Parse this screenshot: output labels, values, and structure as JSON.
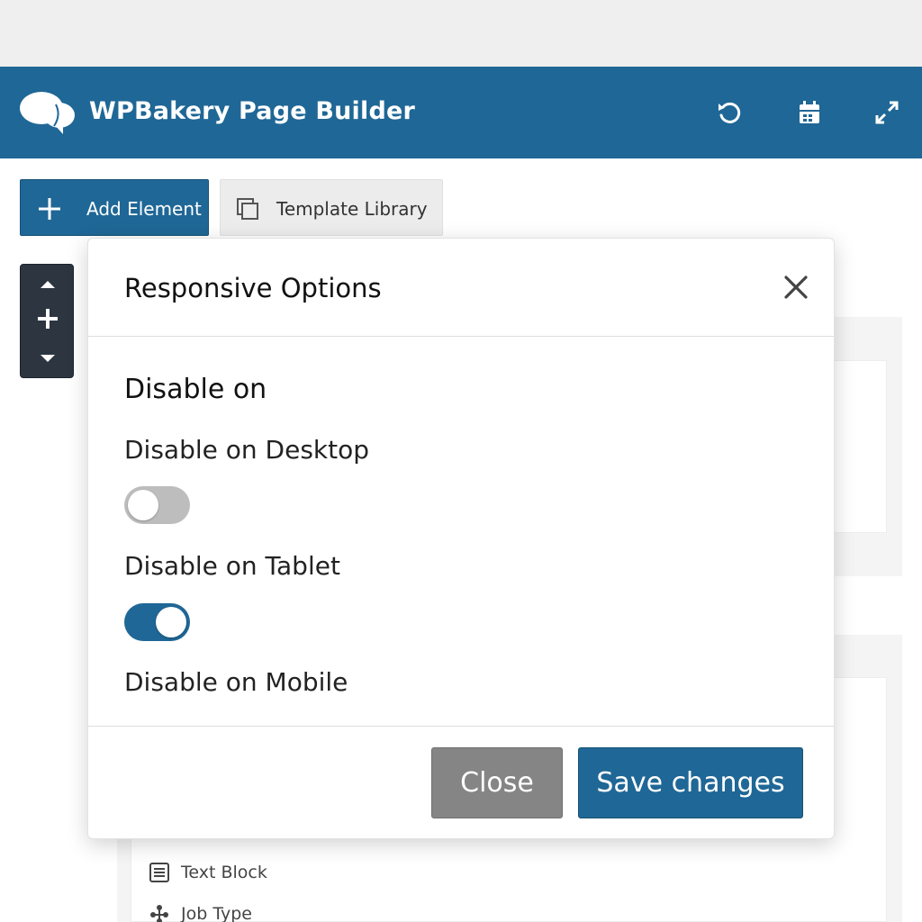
{
  "app": {
    "title": "WPBakery Page Builder"
  },
  "toolbar": {
    "add_element_label": "Add Element",
    "template_library_label": "Template Library"
  },
  "background_elements": [
    {
      "label": "Text Block",
      "icon": "text-block-icon"
    },
    {
      "label": "Job Type",
      "icon": "job-type-icon"
    }
  ],
  "modal": {
    "title": "Responsive Options",
    "section_title": "Disable on",
    "options": [
      {
        "label": "Disable on Desktop",
        "enabled": false
      },
      {
        "label": "Disable on Tablet",
        "enabled": true
      },
      {
        "label": "Disable on Mobile"
      }
    ],
    "close_label": "Close",
    "save_label": "Save changes"
  },
  "colors": {
    "brand": "#1f6796",
    "toggle_off": "#bdbdbd",
    "close_button": "#858585",
    "dark_panel": "#2c3540"
  }
}
